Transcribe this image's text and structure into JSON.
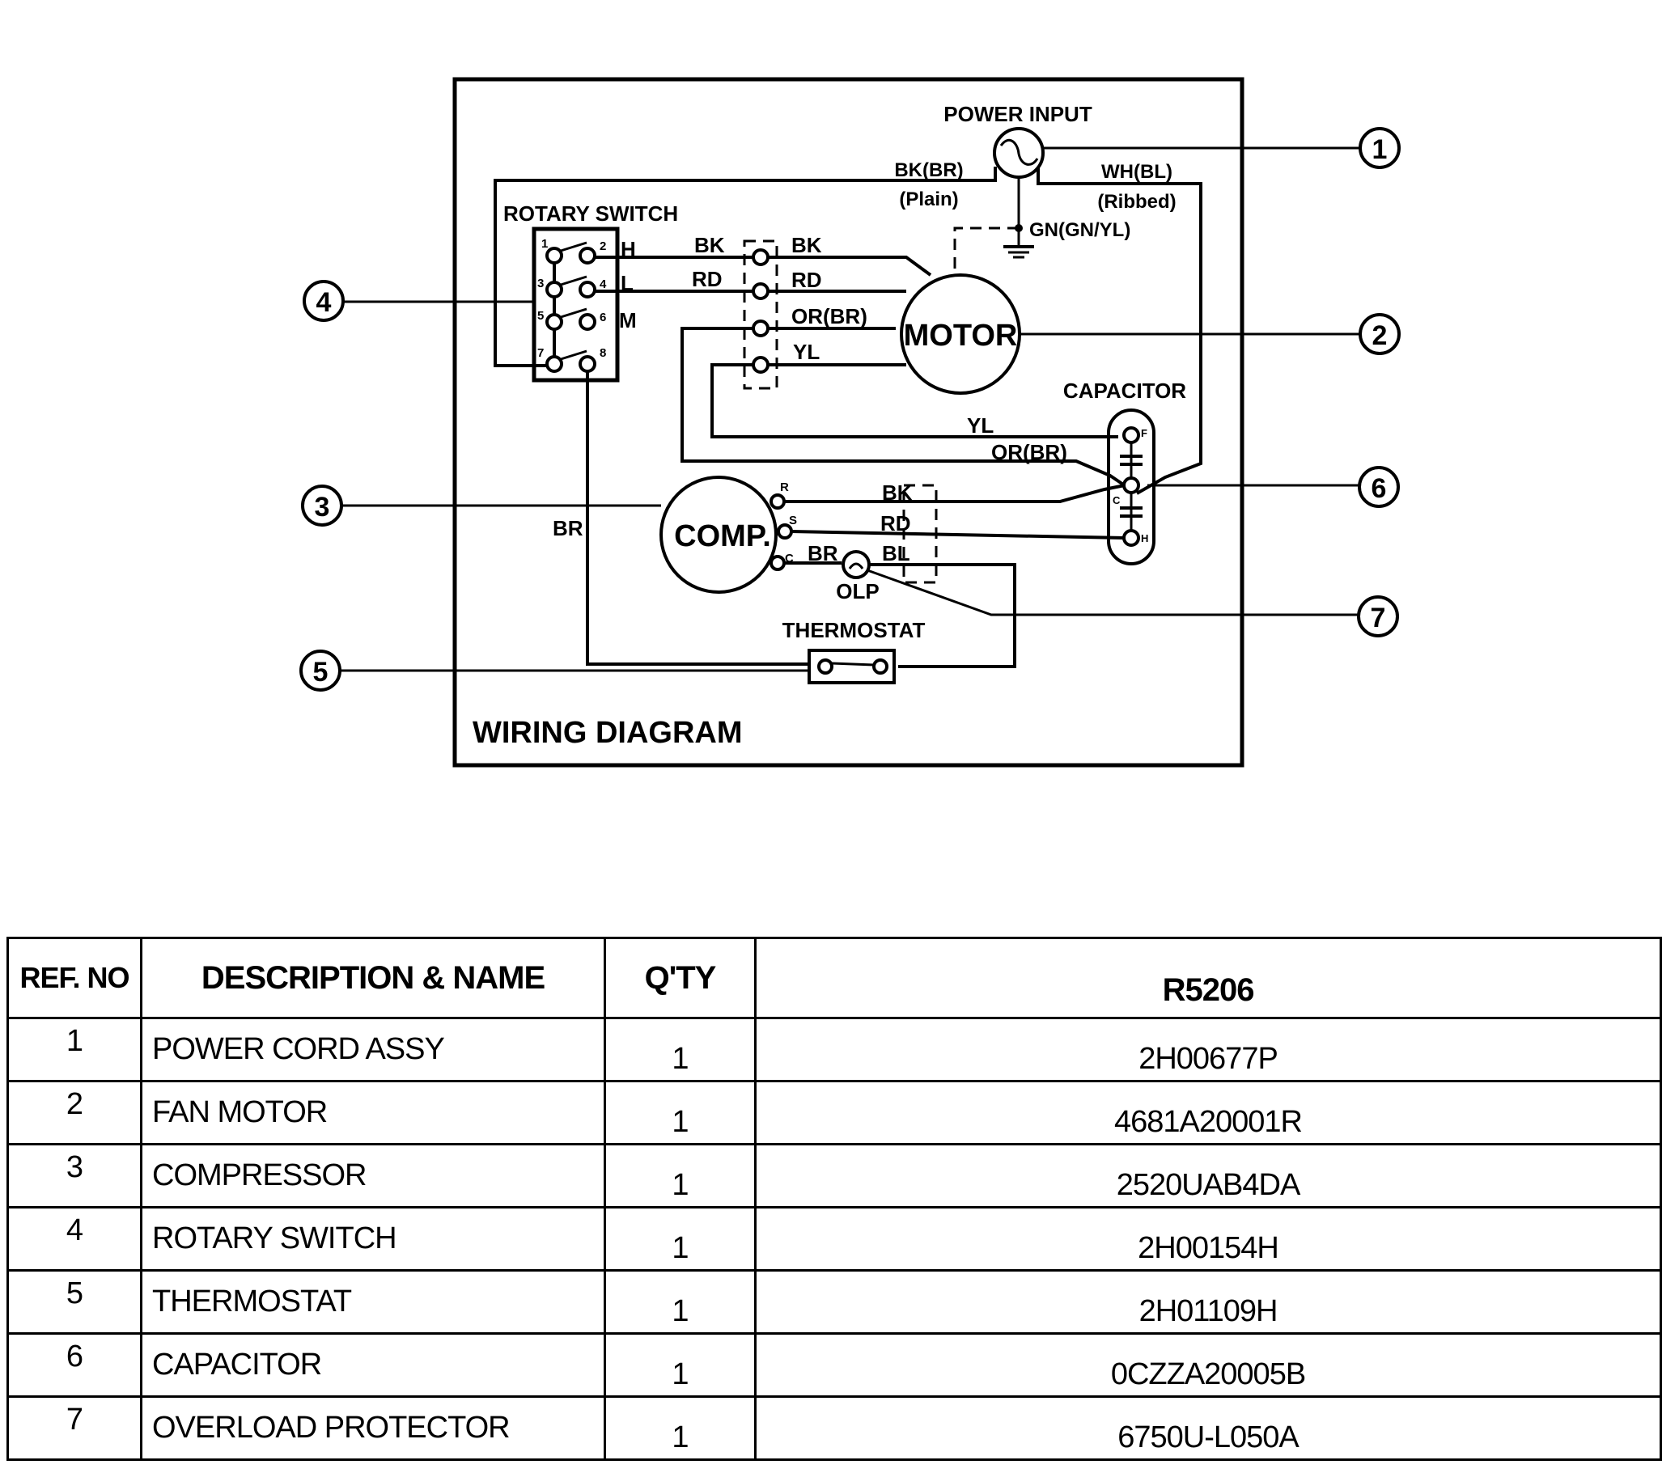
{
  "diagram": {
    "title": "WIRING DIAGRAM",
    "components": {
      "power_input": "POWER INPUT",
      "rotary_switch": "ROTARY SWITCH",
      "motor": "MOTOR",
      "capacitor": "CAPACITOR",
      "compressor": "COMP.",
      "olp": "OLP",
      "thermostat": "THERMOSTAT"
    },
    "wire_labels": {
      "bk_br": "BK(BR)",
      "plain": "(Plain)",
      "wh_bl": "WH(BL)",
      "ribbed": "(Ribbed)",
      "ground": "GN(GN/YL)",
      "bk_left": "BK",
      "rd_left": "RD",
      "bk_right": "BK",
      "rd_right": "RD",
      "or_br": "OR(BR)",
      "yl": "YL",
      "yl_cap": "YL",
      "or_br_cap": "OR(BR)",
      "comp_bk": "BK",
      "comp_rd": "RD",
      "comp_br": "BR",
      "comp_bl": "BL",
      "br_vertical": "BR"
    },
    "switch_terminals": [
      "1",
      "2",
      "3",
      "4",
      "5",
      "6",
      "7",
      "8"
    ],
    "switch_speeds": [
      "H",
      "L",
      "M"
    ],
    "comp_terminals": [
      "R",
      "S",
      "C"
    ],
    "cap_terminals": [
      "F",
      "C",
      "H"
    ],
    "callouts": [
      "1",
      "2",
      "3",
      "4",
      "5",
      "6",
      "7"
    ]
  },
  "table": {
    "headers": {
      "ref": "REF. NO",
      "desc": "DESCRIPTION & NAME",
      "qty": "Q'TY",
      "model": "R5206"
    },
    "rows": [
      {
        "ref": "1",
        "desc": "POWER CORD ASSY",
        "qty": "1",
        "part": "2H00677P"
      },
      {
        "ref": "2",
        "desc": "FAN MOTOR",
        "qty": "1",
        "part": "4681A20001R"
      },
      {
        "ref": "3",
        "desc": "COMPRESSOR",
        "qty": "1",
        "part": "2520UAB4DA"
      },
      {
        "ref": "4",
        "desc": "ROTARY SWITCH",
        "qty": "1",
        "part": "2H00154H"
      },
      {
        "ref": "5",
        "desc": "THERMOSTAT",
        "qty": "1",
        "part": "2H01109H"
      },
      {
        "ref": "6",
        "desc": "CAPACITOR",
        "qty": "1",
        "part": "0CZZA20005B"
      },
      {
        "ref": "7",
        "desc": "OVERLOAD PROTECTOR",
        "qty": "1",
        "part": "6750U-L050A"
      }
    ]
  }
}
